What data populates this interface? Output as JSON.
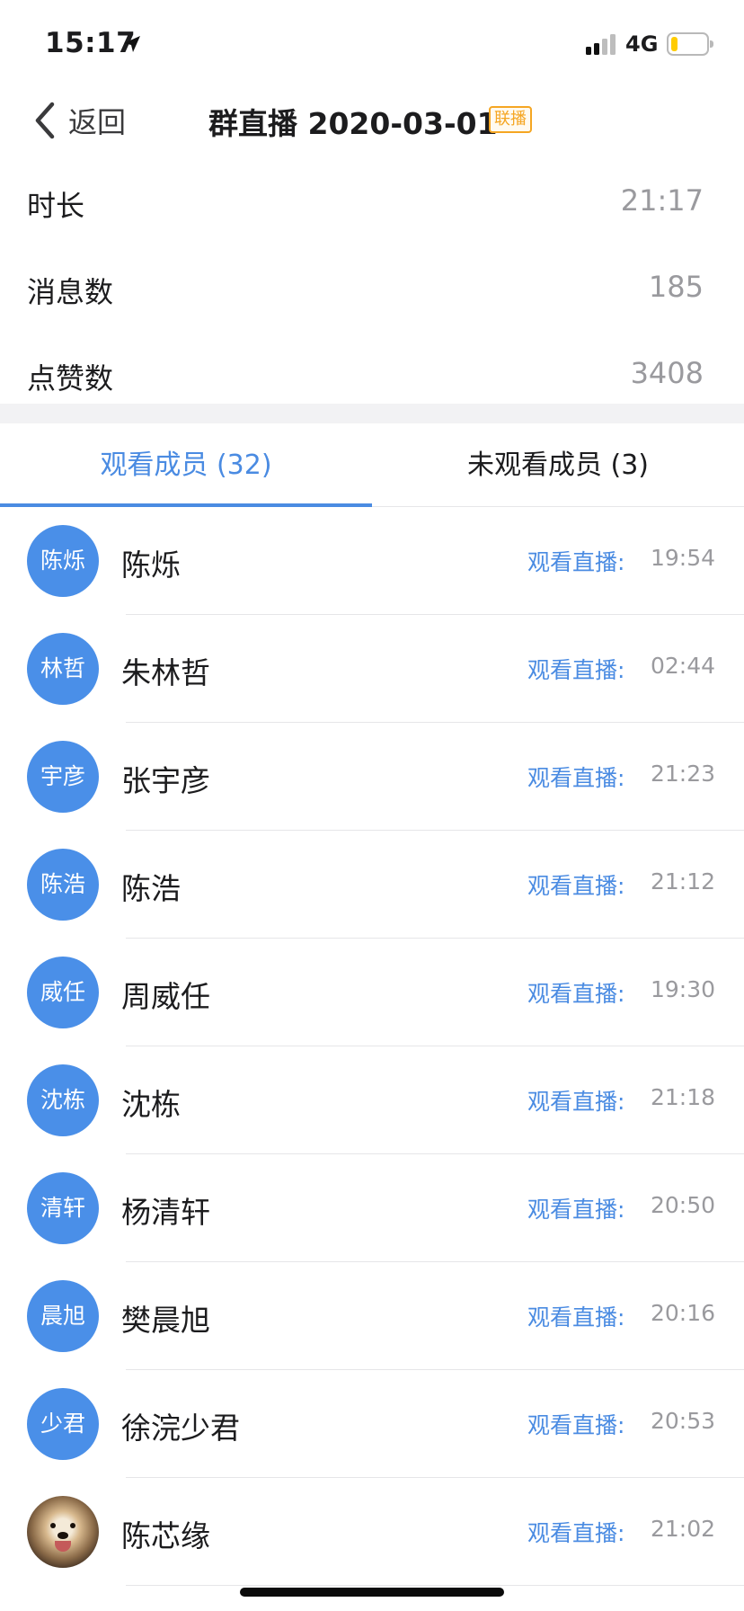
{
  "status_bar": {
    "time": "15:17",
    "network": "4G",
    "battery_level": 0.2,
    "battery_color": "#ffcc00",
    "location_icon": "location-arrow-icon"
  },
  "nav": {
    "back_label": "返回",
    "title": "群直播 2020-03-01",
    "badge": "联播"
  },
  "stats": [
    {
      "label": "时长",
      "value": "21:17"
    },
    {
      "label": "消息数",
      "value": "185"
    },
    {
      "label": "点赞数",
      "value": "3408"
    }
  ],
  "tabs": {
    "watched": "观看成员 (32)",
    "unwatched": "未观看成员 (3)",
    "active": "watched"
  },
  "members": [
    {
      "avatar": "陈烁",
      "name": "陈烁",
      "label": "观看直播:",
      "time": "19:54"
    },
    {
      "avatar": "林哲",
      "name": "朱林哲",
      "label": "观看直播:",
      "time": "02:44"
    },
    {
      "avatar": "宇彦",
      "name": "张宇彦",
      "label": "观看直播:",
      "time": "21:23"
    },
    {
      "avatar": "陈浩",
      "name": "陈浩",
      "label": "观看直播:",
      "time": "21:12"
    },
    {
      "avatar": "威任",
      "name": "周威任",
      "label": "观看直播:",
      "time": "19:30"
    },
    {
      "avatar": "沈栋",
      "name": "沈栋",
      "label": "观看直播:",
      "time": "21:18"
    },
    {
      "avatar": "清轩",
      "name": "杨清轩",
      "label": "观看直播:",
      "time": "20:50"
    },
    {
      "avatar": "晨旭",
      "name": "樊晨旭",
      "label": "观看直播:",
      "time": "20:16"
    },
    {
      "avatar": "少君",
      "name": "徐浣少君",
      "label": "观看直播:",
      "time": "20:53"
    },
    {
      "avatar": "",
      "avatar_icon": "dog-photo-avatar",
      "name": "陈芯缘",
      "label": "观看直播:",
      "time": "21:02"
    }
  ],
  "colors": {
    "accent": "#4a8be2",
    "avatar_bg": "#4a8fe8",
    "badge": "#f5a623",
    "secondary_text": "#9a9a9e"
  }
}
